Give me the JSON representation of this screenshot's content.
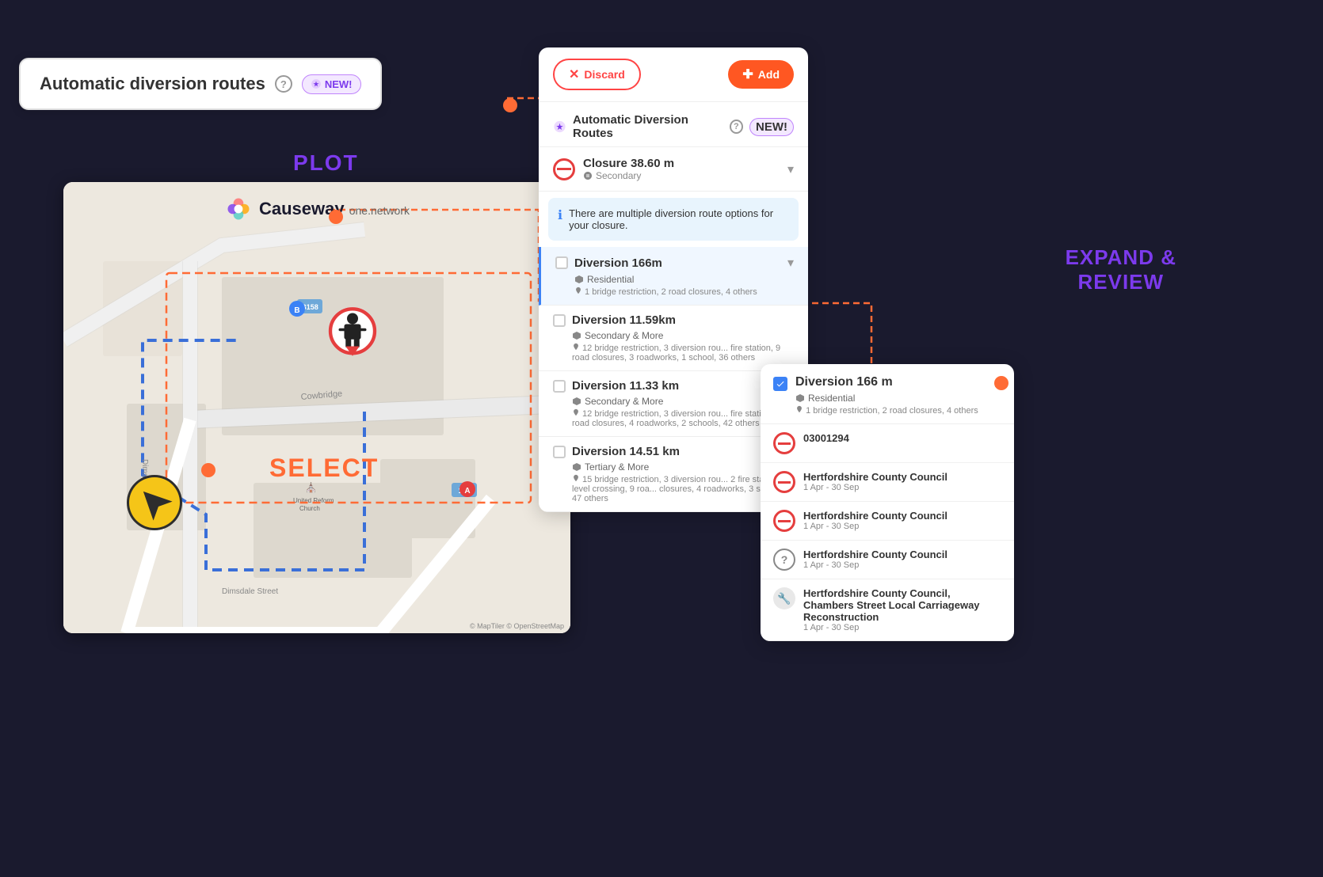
{
  "background": "#111122",
  "badge": {
    "text": "Automatic diversion routes",
    "help": "?",
    "new_label": "NEW!"
  },
  "plot_label": "PLOT",
  "select_label": "SELECT",
  "expand_label": "EXPAND &\nREVIEW",
  "map": {
    "logo_name": "Causeway",
    "logo_sub": "one.network",
    "attribution": "© MapTiler © OpenStreetMap"
  },
  "panel": {
    "discard_label": "Discard",
    "add_label": "Add",
    "section_title": "Automatic Diversion Routes",
    "new_label": "NEW!",
    "help": "?",
    "closure": {
      "title": "Closure 38.60 m",
      "subtitle": "Secondary"
    },
    "info_message": "There are multiple diversion route options for your closure.",
    "diversions": [
      {
        "id": 1,
        "title": "Diversion 166m",
        "road_type": "Residential",
        "detail": "1 bridge restriction, 2 road closures, 4 others",
        "checked": false
      },
      {
        "id": 2,
        "title": "Diversion 11.59km",
        "road_type": "Secondary & More",
        "detail": "12 bridge restriction, 3 diversion rou... fire station, 9 road closures, 3 roadworks, 1 school, 36 others",
        "checked": false
      },
      {
        "id": 3,
        "title": "Diversion 11.33 km",
        "road_type": "Secondary & More",
        "detail": "12 bridge restriction, 3 diversion rou... fire station, 11 road closures, 4 roadworks, 2 schools, 42 others",
        "checked": false
      },
      {
        "id": 4,
        "title": "Diversion 14.51 km",
        "road_type": "Tertiary & More",
        "detail": "15 bridge restriction, 3 diversion rou... 2 fire stations, 1 level crossing, 9 roa... closures, 4 roadworks, 3 schools, 47 others",
        "checked": false
      }
    ]
  },
  "expanded": {
    "title": "Diversion 166 m",
    "road_type": "Residential",
    "detail": "1 bridge restriction, 2 road closures, 4 others",
    "checked": true,
    "conflicts": [
      {
        "id": "03001294",
        "icon_type": "restrict",
        "color": "#e53e3e",
        "title": "03001294",
        "subtitle": ""
      },
      {
        "id": "hcc1",
        "icon_type": "restrict",
        "color": "#e53e3e",
        "title": "Hertfordshire County Council",
        "subtitle": "1 Apr - 30 Sep"
      },
      {
        "id": "hcc2",
        "icon_type": "restrict",
        "color": "#e53e3e",
        "title": "Hertfordshire County Council",
        "subtitle": "1 Apr - 30 Sep"
      },
      {
        "id": "hcc3",
        "icon_type": "question",
        "color": "#888",
        "title": "Hertfordshire County Council",
        "subtitle": "1 Apr - 30 Sep"
      },
      {
        "id": "hcc4",
        "icon_type": "construction",
        "color": "#555",
        "title": "Hertfordshire County Council, Chambers Street Local Carriageway Reconstruction",
        "subtitle": "1 Apr - 30 Sep"
      }
    ]
  },
  "colors": {
    "orange": "#ff6b35",
    "purple": "#7c3aed",
    "blue": "#3a6fd8",
    "red": "#e53e3e"
  }
}
